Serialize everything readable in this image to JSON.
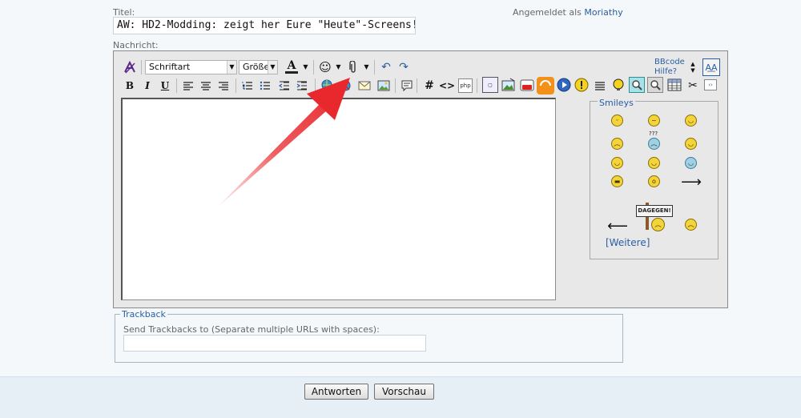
{
  "form": {
    "title_label": "Titel:",
    "title_value": "AW: HD2-Modding: zeigt her Eure \"Heute\"-Screens!",
    "message_label": "Nachricht:",
    "logged_in_prefix": "Angemeldet als",
    "username": "Moriathy"
  },
  "toolbar": {
    "font_select": "Schriftart",
    "size_select": "Größe",
    "bold": "B",
    "italic": "I",
    "underline": "U",
    "hash": "#",
    "code": "<>",
    "php": "php",
    "bbcode": "BBcode",
    "help": "Hilfe?",
    "colors": {
      "accent_link": "#2a5ea3",
      "text_color_bar": "#222222",
      "highlight_red": "#e8282c"
    }
  },
  "smileys": {
    "legend": "Smileys",
    "sign_text": "DAGEGEN!",
    "question_marks": "???",
    "more_link": "[Weitere]"
  },
  "trackback": {
    "legend": "Trackback",
    "label": "Send Trackbacks to (Separate multiple URLs with spaces):"
  },
  "actions": {
    "reply": "Antworten",
    "preview": "Vorschau"
  }
}
